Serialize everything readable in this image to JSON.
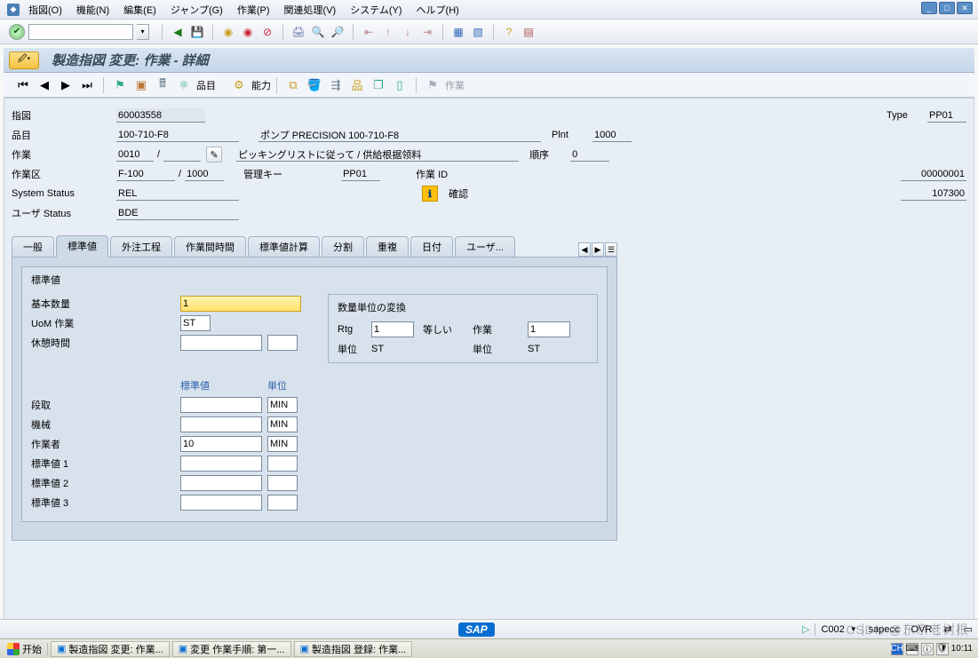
{
  "menu": {
    "m1": "指図(O)",
    "m2": "機能(N)",
    "m3": "編集(E)",
    "m4": "ジャンプ(G)",
    "m5": "作業(P)",
    "m6": "関連処理(V)",
    "m7": "システム(Y)",
    "m8": "ヘルプ(H)"
  },
  "title": "製造指図 変更: 作業 - 詳細",
  "apptb": {
    "hinmoku": "品目",
    "nouryoku": "能力",
    "sagyo": "作業"
  },
  "hdr": {
    "sashizu_lbl": "指図",
    "sashizu": "60003558",
    "type_lbl": "Type",
    "type": "PP01",
    "hinmoku_lbl": "品目",
    "hinmoku": "100-710-F8",
    "hinmoku_txt": "ポンプ PRECISION 100-710-F8",
    "plnt_lbl": "Plnt",
    "plnt": "1000",
    "oper_lbl": "作業",
    "oper": "0010",
    "oper_slash": "/",
    "oper_txt": "ピッキングリストに従って / 供給根据领料",
    "seq_lbl": "順序",
    "seq": "0",
    "wc_lbl": "作業区",
    "wc": "F-100",
    "wc_plant": "1000",
    "ctrlkey_lbl": "管理キー",
    "ctrlkey": "PP01",
    "operid_lbl": "作業 ID",
    "operid": "00000001",
    "sys_lbl": "System Status",
    "sys": "REL",
    "conf_lbl": "確認",
    "conf": "107300",
    "usr_lbl": "ユーザ Status",
    "usr": "BDE"
  },
  "tabs": {
    "t0": "一般",
    "t1": "標準値",
    "t2": "外注工程",
    "t3": "作業間時間",
    "t4": "標準値計算",
    "t5": "分割",
    "t6": "重複",
    "t7": "日付",
    "t8": "ユーザ..."
  },
  "std": {
    "group": "標準値",
    "baseqty_lbl": "基本数量",
    "baseqty": "1",
    "uom_lbl": "UoM 作業",
    "uom": "ST",
    "break_lbl": "休憩時間",
    "break": "",
    "conv_group": "数量単位の変換",
    "rtg_lbl": "Rtg",
    "rtg": "1",
    "equal": "等しい",
    "oper_lbl": "作業",
    "oper": "1",
    "unit_lbl": "単位",
    "unit1": "ST",
    "unit2": "ST",
    "col_std": "標準値",
    "col_unit": "単位",
    "r1": "段取",
    "r1u": "MIN",
    "r1v": "",
    "r2": "機械",
    "r2u": "MIN",
    "r2v": "",
    "r3": "作業者",
    "r3u": "MIN",
    "r3v": "10",
    "r4": "標準値 1",
    "r4u": "",
    "r4v": "",
    "r5": "標準値 2",
    "r5u": "",
    "r5v": "",
    "r6": "標準値 3",
    "r6u": "",
    "r6v": ""
  },
  "status": {
    "client": "C002",
    "sys": "sapecc",
    "ovr": "OVR"
  },
  "taskbar": {
    "start": "开始",
    "t1": "製造指図 変更: 作業...",
    "t2": "変更 作業手順: 第一...",
    "t3": "製造指図 登録: 作業...",
    "time": "10:11"
  },
  "watermark": "CSDN @东京老树根"
}
